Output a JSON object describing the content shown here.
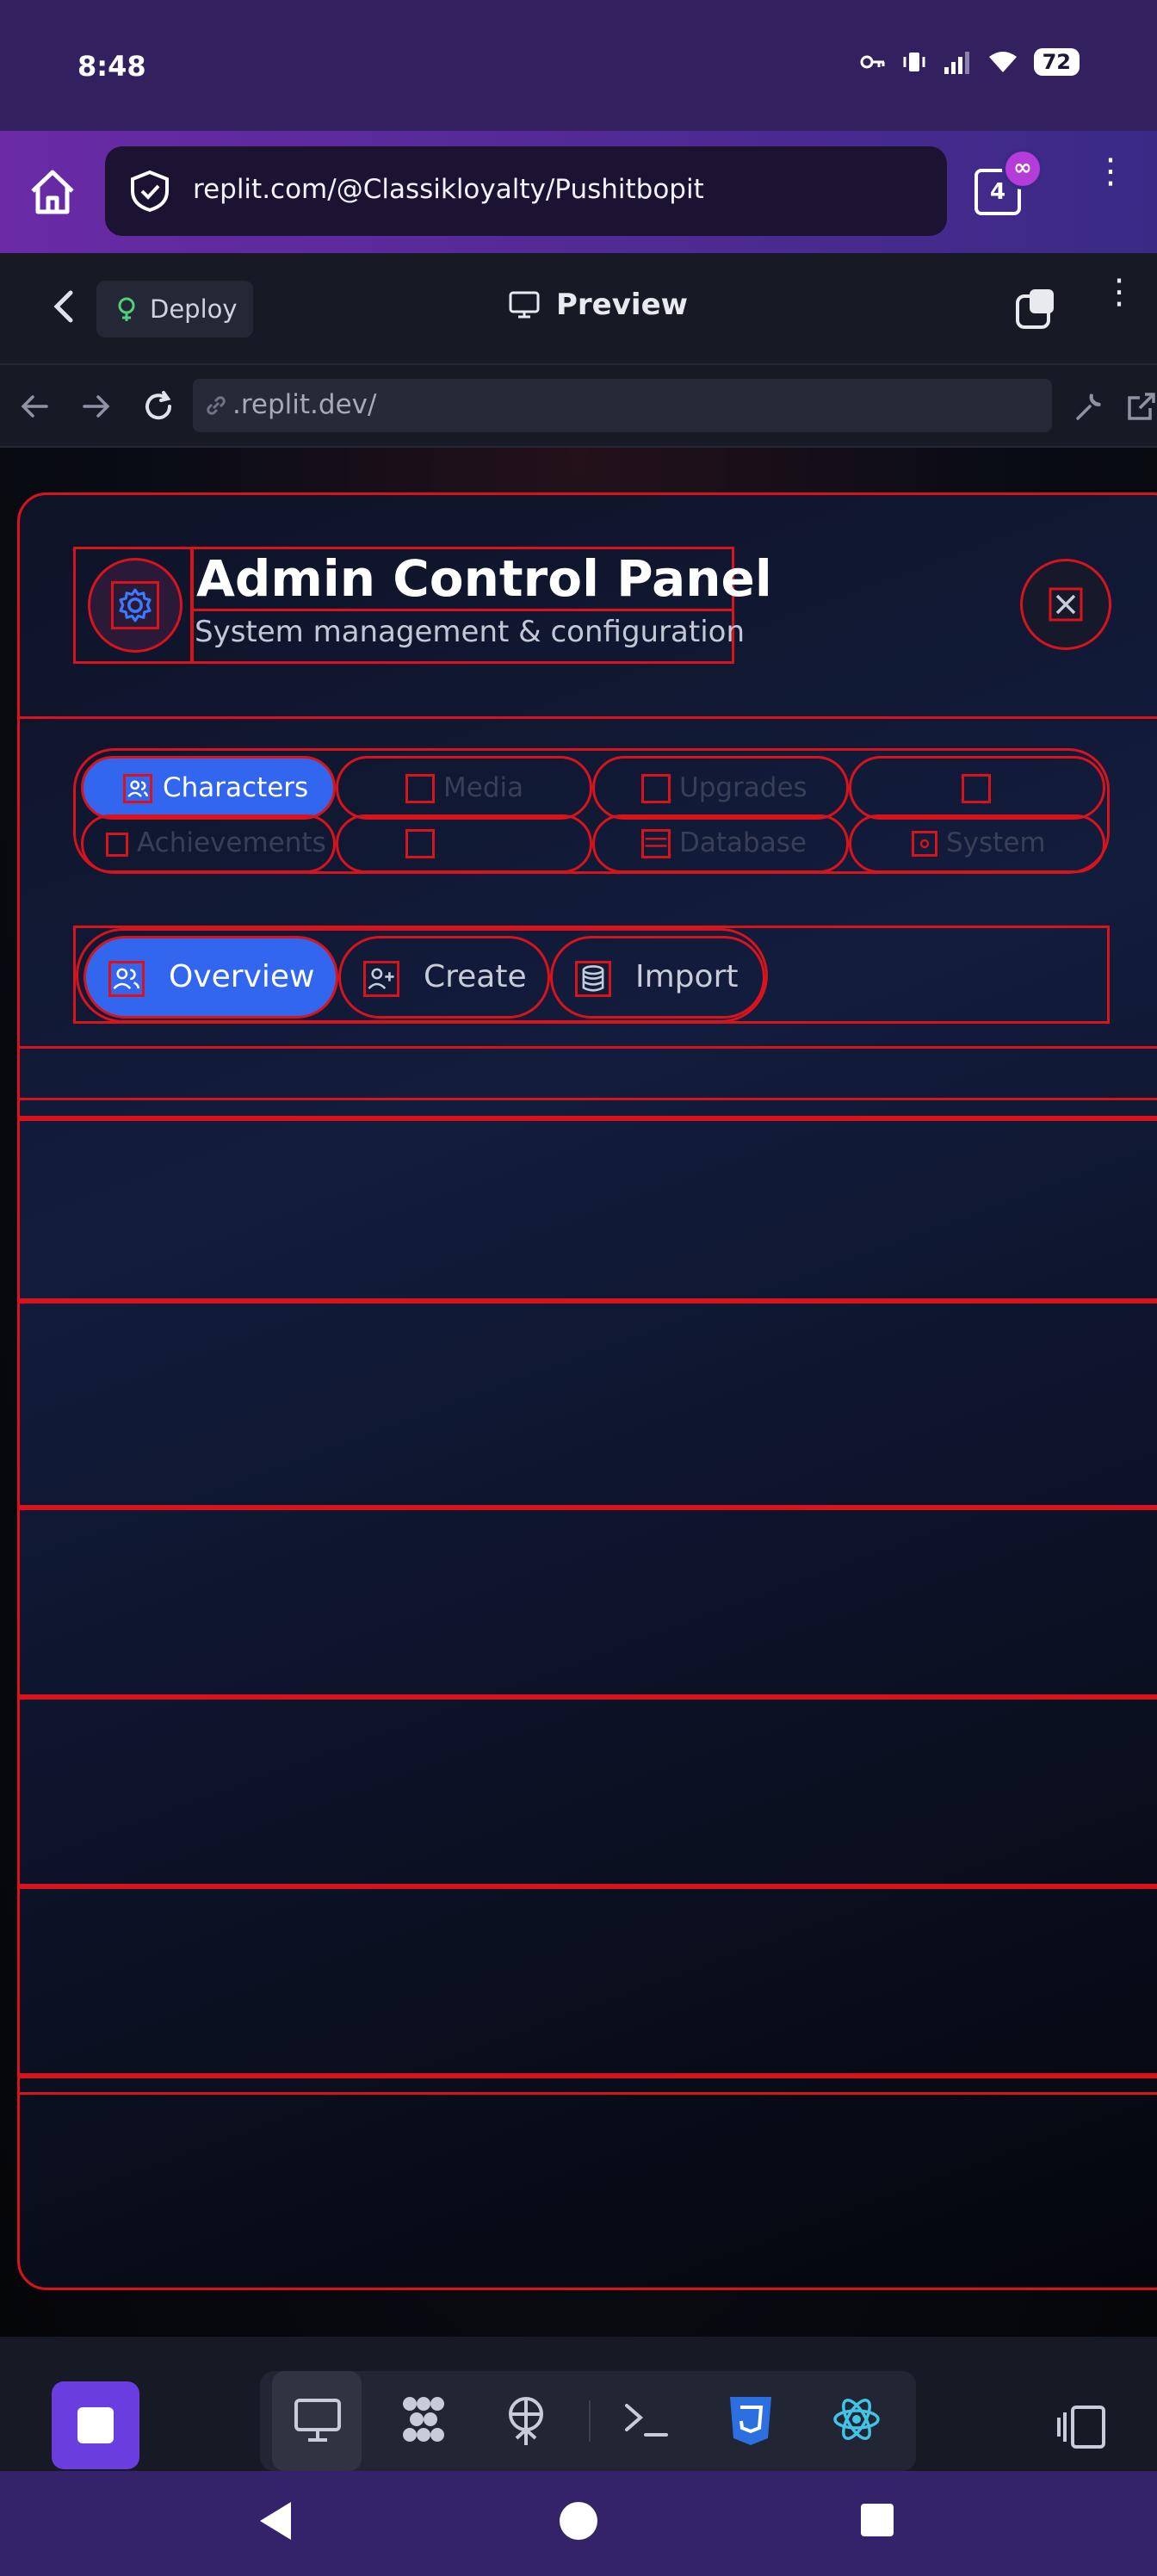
{
  "status_bar": {
    "time": "8:48",
    "battery": "72",
    "icons": [
      "key-icon",
      "vibrate-icon",
      "signal-icon",
      "wifi-icon",
      "battery-icon"
    ]
  },
  "browser": {
    "url": "replit.com/@Classikloyalty/Pushitbopit",
    "tab_count": "4",
    "tab_badge": "∞",
    "menu_glyph": "⋮"
  },
  "replit_header": {
    "deploy_label": "Deploy",
    "preview_label": "Preview",
    "menu_glyph": "⋮"
  },
  "web_bar": {
    "address": ".replit.dev/"
  },
  "admin_panel": {
    "title": "Admin Control Panel",
    "subtitle": "System management & configuration",
    "category_tabs": [
      {
        "label": "Characters",
        "active": true
      },
      {
        "label": "Media",
        "active": false
      },
      {
        "label": "Upgrades",
        "active": false
      },
      {
        "label": "",
        "active": false
      },
      {
        "label": "Achievements",
        "active": false
      },
      {
        "label": "",
        "active": false
      },
      {
        "label": "Database",
        "active": false
      },
      {
        "label": "System",
        "active": false
      }
    ],
    "sub_tabs": [
      {
        "label": "Overview",
        "active": true
      },
      {
        "label": "Create",
        "active": false
      },
      {
        "label": "Import",
        "active": false
      }
    ]
  },
  "colors": {
    "accent_blue": "#3366ee",
    "outline_red": "#d8131c",
    "status_bar_purple": "#33205f",
    "stop_button_purple": "#6a3dde"
  }
}
